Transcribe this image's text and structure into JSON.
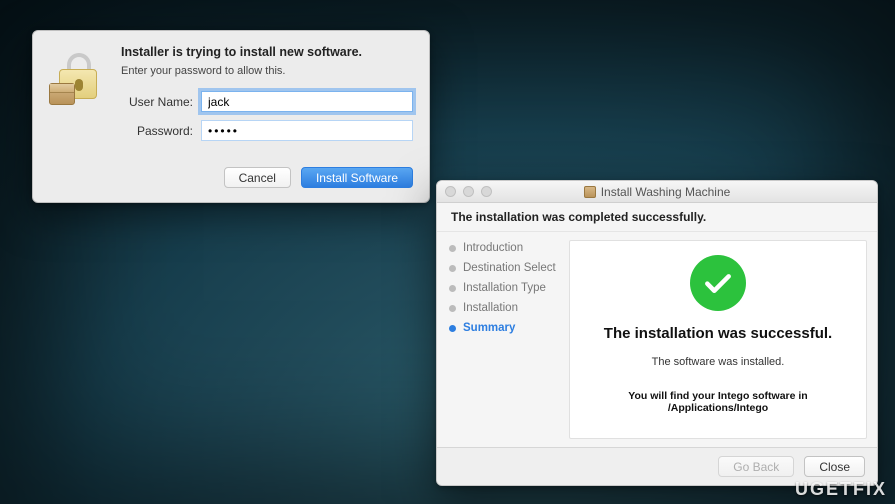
{
  "watermark": "UGETFIX",
  "auth": {
    "title": "Installer is trying to install new software.",
    "instruction": "Enter your password to allow this.",
    "username_label": "User Name:",
    "password_label": "Password:",
    "username_value": "jack",
    "password_value": "•••••",
    "cancel_label": "Cancel",
    "submit_label": "Install Software",
    "icons": {
      "lock": "lock-icon",
      "package_badge": "package-icon"
    }
  },
  "installer": {
    "window_title": "Install Washing Machine",
    "header": "The installation was completed successfully.",
    "steps": [
      {
        "label": "Introduction",
        "active": false
      },
      {
        "label": "Destination Select",
        "active": false
      },
      {
        "label": "Installation Type",
        "active": false
      },
      {
        "label": "Installation",
        "active": false
      },
      {
        "label": "Summary",
        "active": true
      }
    ],
    "success_title": "The installation was successful.",
    "success_sub": "The software was installed.",
    "success_note": "You will find your Intego software in /Applications/Intego",
    "go_back_label": "Go Back",
    "close_label": "Close",
    "colors": {
      "accent": "#2d7ee0",
      "success": "#2cc23d"
    }
  }
}
